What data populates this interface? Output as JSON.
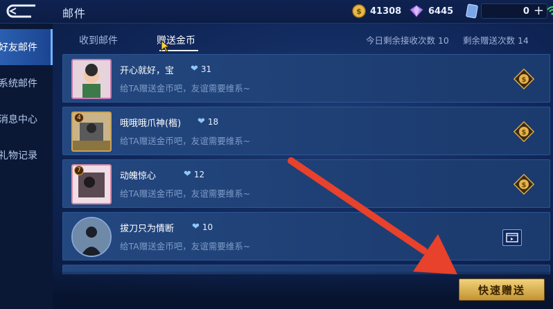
{
  "header": {
    "title": "邮件",
    "gold": "41308",
    "gems": "6445",
    "tickets": "0",
    "plus_label": "+"
  },
  "sidebar": {
    "items": [
      {
        "label": "好友邮件",
        "active": true
      },
      {
        "label": "系统邮件",
        "active": false
      },
      {
        "label": "消息中心",
        "active": false
      },
      {
        "label": "礼物记录",
        "active": false
      }
    ]
  },
  "tabs": [
    {
      "label": "收到邮件",
      "active": false
    },
    {
      "label": "赠送金币",
      "active": true
    }
  ],
  "counts": {
    "receive_left": "今日剩余接收次数 10",
    "send_left": "剩余赠送次数 14"
  },
  "friends": [
    {
      "name": "开心就好，宝",
      "intimacy": "31",
      "desc": "给TA赠送金币吧，友谊需要维系~",
      "level": ""
    },
    {
      "name": "哦哦哦爪神(楷)",
      "intimacy": "18",
      "desc": "给TA赠送金币吧，友谊需要维系~",
      "level": "4"
    },
    {
      "name": "动魄惊心",
      "intimacy": "12",
      "desc": "给TA赠送金币吧，友谊需要维系~",
      "level": "7"
    },
    {
      "name": "拔刀只为情断",
      "intimacy": "10",
      "desc": "给TA赠送金币吧，友谊需要维系~",
      "level": ""
    }
  ],
  "quick_send_label": "快速赠送",
  "colors": {
    "accent_gold": "#e3b94e",
    "active_sidebar": "#2b5fb0",
    "arrow_red": "#e8412c"
  }
}
